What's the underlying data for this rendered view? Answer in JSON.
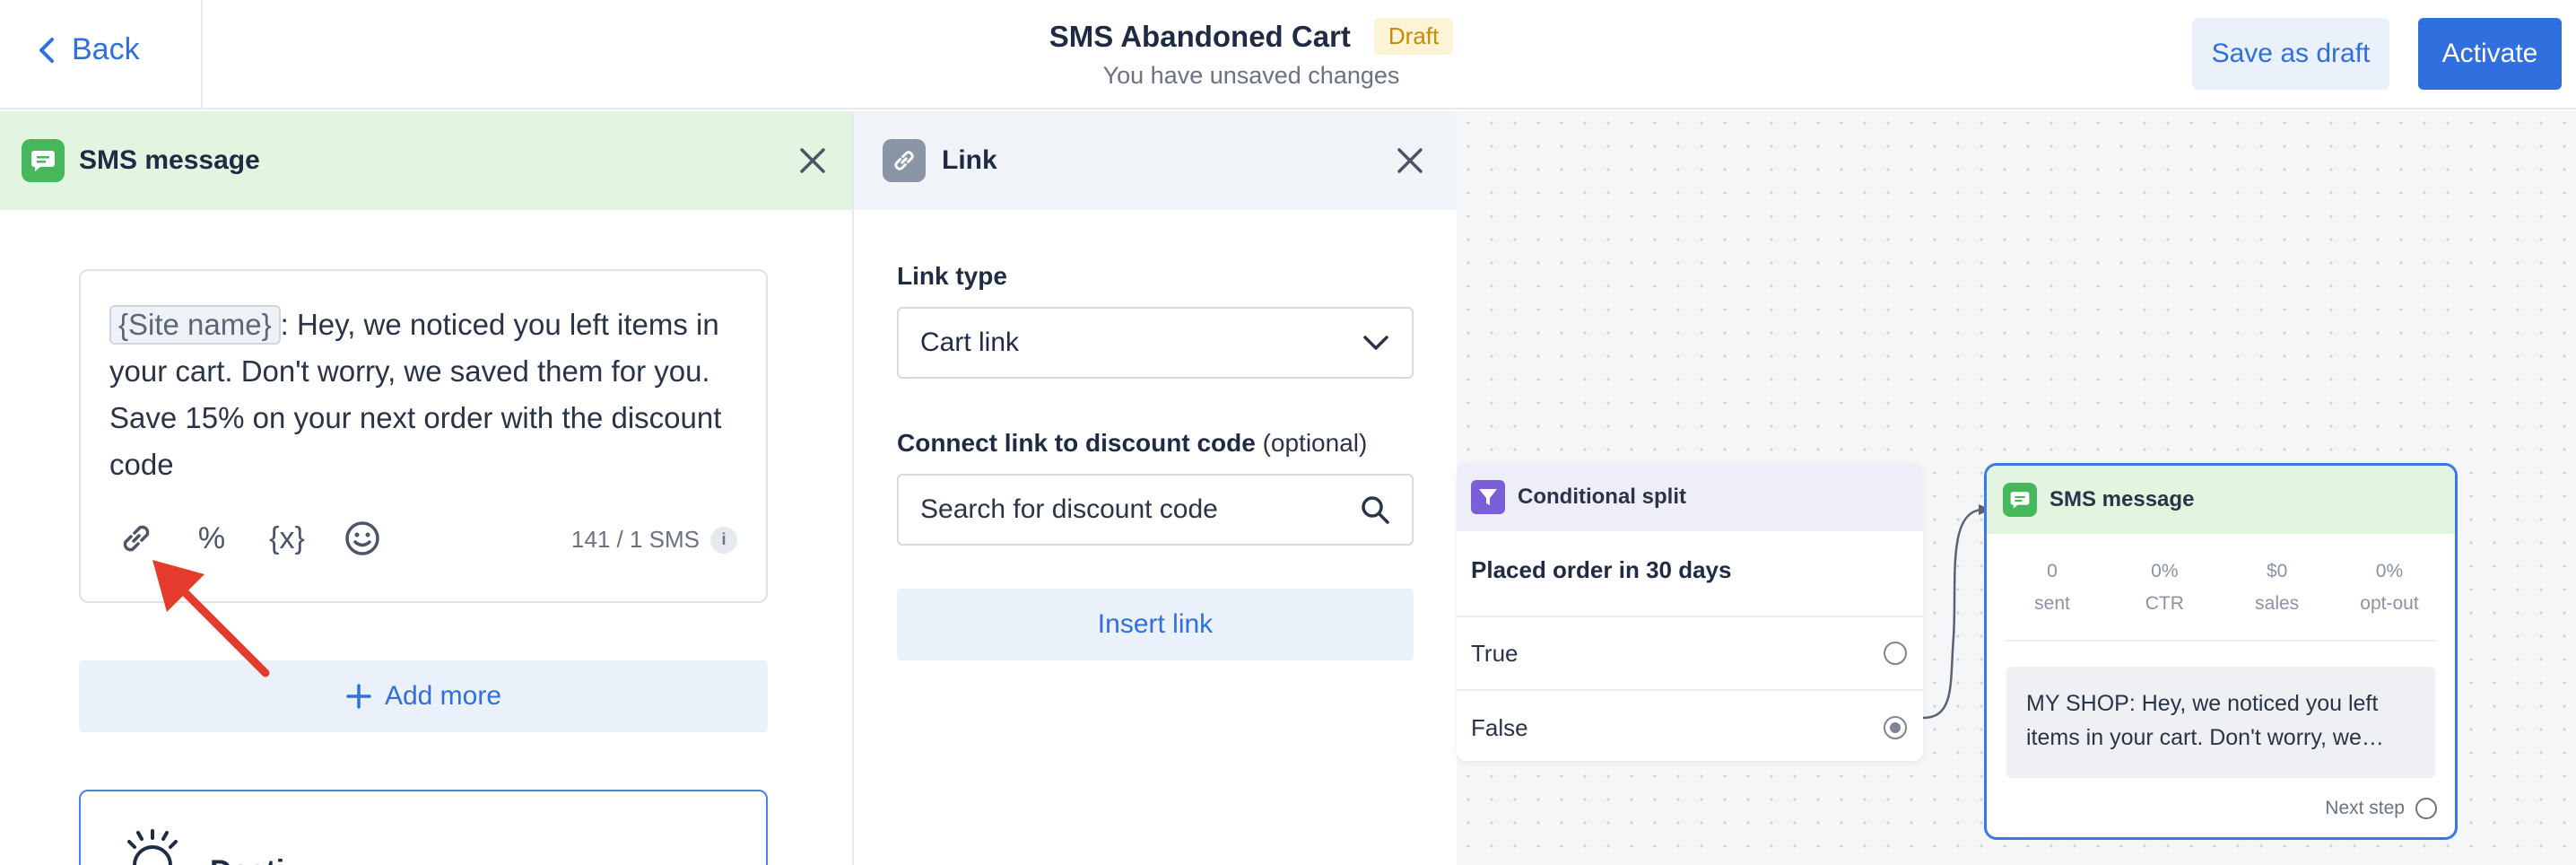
{
  "header": {
    "back_label": "Back",
    "title": "SMS Abandoned Cart",
    "status_badge": "Draft",
    "subtitle": "You have unsaved changes",
    "save_draft_label": "Save as draft",
    "activate_label": "Activate"
  },
  "sms_panel": {
    "title": "SMS message",
    "message_tag": "{Site name}",
    "message_text": ": Hey, we noticed you left items in your cart. Don't worry, we saved them for you. Save 15% on your next order with the discount code",
    "tool_percent": "%",
    "tool_variable": "{x}",
    "char_count": "141 / 1 SMS",
    "info_symbol": "i",
    "add_more_label": "Add more",
    "next_card_label": "Desti..."
  },
  "link_panel": {
    "title": "Link",
    "link_type_label": "Link type",
    "link_type_value": "Cart link",
    "discount_label": "Connect link to discount code",
    "discount_optional": "(optional)",
    "search_placeholder": "Search for discount code",
    "insert_label": "Insert link"
  },
  "canvas": {
    "split": {
      "title": "Conditional split",
      "condition": "Placed order in 30 days",
      "options": [
        {
          "label": "True",
          "selected": false
        },
        {
          "label": "False",
          "selected": true
        }
      ]
    },
    "sms_node": {
      "title": "SMS message",
      "stats": [
        {
          "value": "0",
          "label": "sent"
        },
        {
          "value": "0%",
          "label": "CTR"
        },
        {
          "value": "$0",
          "label": "sales"
        },
        {
          "value": "0%",
          "label": "opt-out"
        }
      ],
      "preview": "MY SHOP: Hey, we noticed you left items in your cart. Don't worry, we…",
      "next_step_label": "Next step"
    }
  },
  "colors": {
    "accent": "#2f6fde",
    "sms_green": "#46b85c",
    "split_purple": "#7b5fd9",
    "arrow_red": "#e53b2c",
    "badge_bg": "#fdf3d6"
  },
  "icons": [
    "chevron-left-icon",
    "close-icon",
    "sms-icon",
    "link-icon",
    "percent-icon",
    "variable-icon",
    "emoji-icon",
    "info-icon",
    "plus-icon",
    "chevron-down-icon",
    "search-icon",
    "funnel-icon",
    "sun-icon"
  ]
}
